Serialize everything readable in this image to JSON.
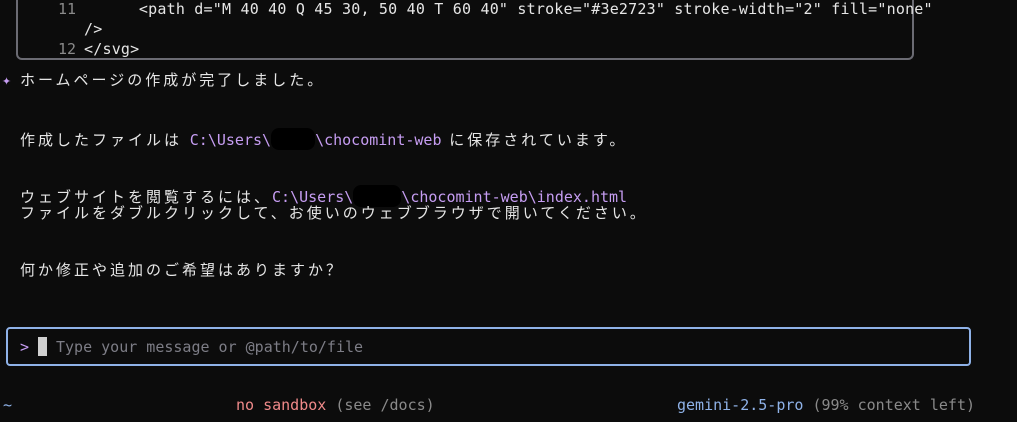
{
  "code_block": {
    "lines": [
      {
        "number": "11",
        "text": "    <path d=\"M 40 40 Q 45 30, 50 40 T 60 40\" stroke=\"#3e2723\" stroke-width=\"2\" fill=\"none\""
      },
      {
        "number": "",
        "text": "/>"
      },
      {
        "number": "12",
        "text": "</svg>"
      }
    ]
  },
  "response": {
    "icon": "sparkle-icon",
    "heading": "ホームページの作成が完了しました。",
    "saved_prefix": "作成したファイルは ",
    "saved_path_a": "C:\\Users\\",
    "saved_path_b": "\\chocomint-web",
    "saved_suffix": " に保存されています。",
    "view_prefix": "ウェブサイトを閲覧するには、",
    "view_path_a": "C:\\Users\\",
    "view_path_b": "\\chocomint-web\\index.html",
    "view_line2": "ファイルをダブルクリックして、お使いのウェブブラウザで開いてください。",
    "question": "何か修正や追加のご希望はありますか？"
  },
  "input": {
    "prompt_symbol": ">",
    "placeholder": "Type your message or @path/to/file",
    "value": ""
  },
  "footer": {
    "cwd": "~",
    "sandbox_label": "no sandbox",
    "sandbox_hint": " (see /docs)",
    "model": "gemini-2.5-pro",
    "context": " (99% context left)"
  },
  "colors": {
    "background": "#0c0c0c",
    "accent_purple": "#c69df2",
    "accent_blue": "#8fb2e8",
    "warning_red": "#f08a8a"
  }
}
